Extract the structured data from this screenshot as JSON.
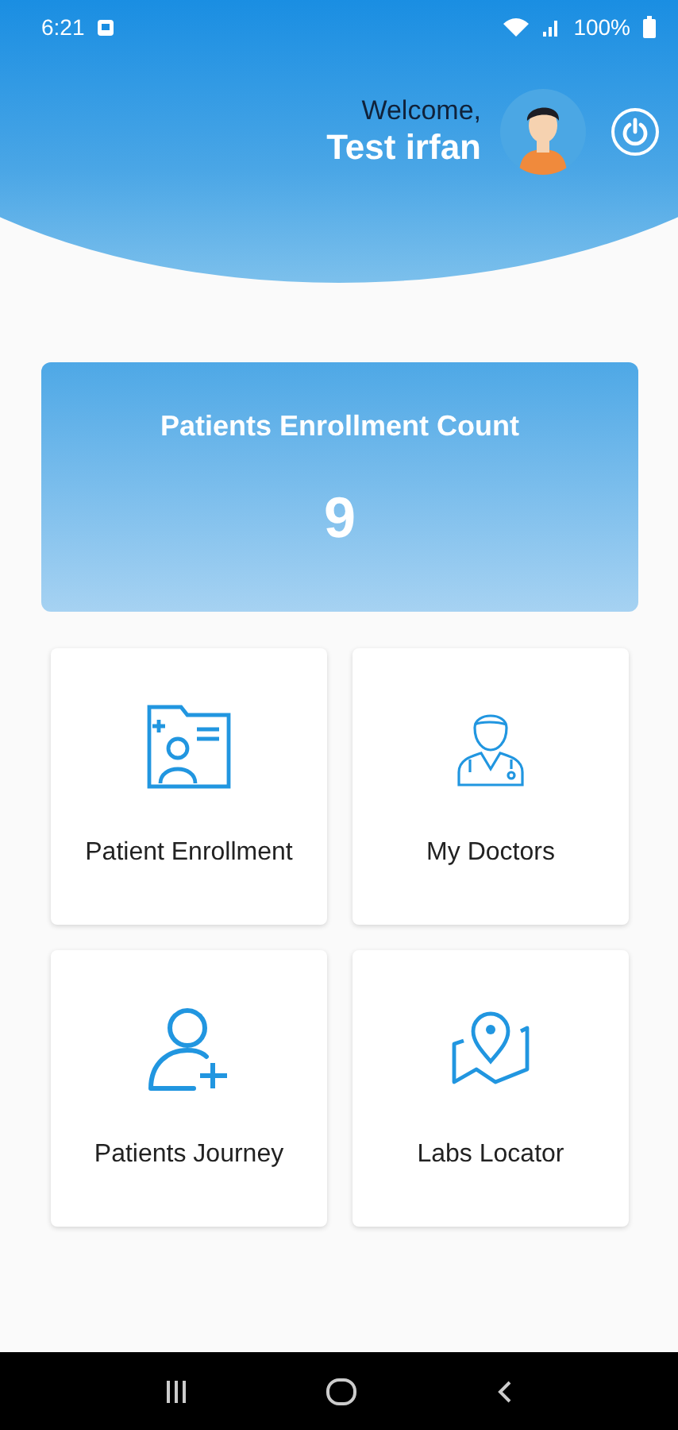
{
  "status_bar": {
    "time": "6:21",
    "battery": "100%"
  },
  "header": {
    "greeting": "Welcome,",
    "user_name": "Test irfan"
  },
  "count_card": {
    "title": "Patients Enrollment Count",
    "value": "9"
  },
  "tiles": [
    {
      "kind": "enrollment",
      "label": "Patient Enrollment"
    },
    {
      "kind": "doctors",
      "label": "My Doctors"
    },
    {
      "kind": "journey",
      "label": "Patients Journey"
    },
    {
      "kind": "labs",
      "label": "Labs Locator"
    }
  ]
}
